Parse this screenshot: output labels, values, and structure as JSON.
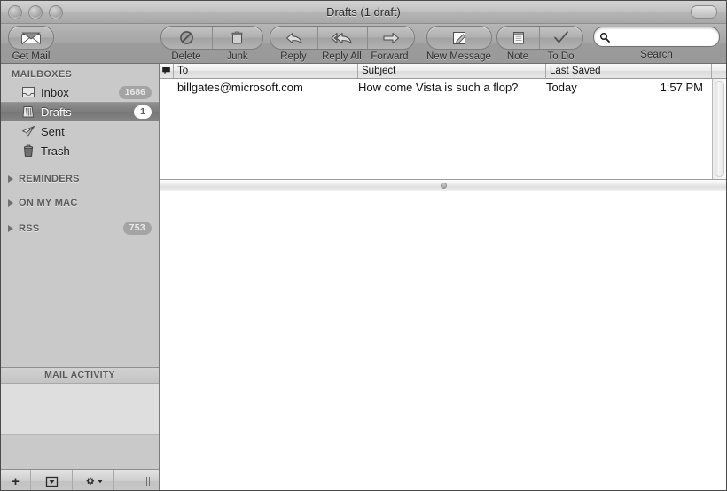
{
  "window": {
    "title": "Drafts (1 draft)",
    "traffic_lights": [
      "close",
      "minimize",
      "zoom"
    ],
    "toolbar_toggle": "toolbar-toggle-pill"
  },
  "toolbar": {
    "get_mail": {
      "label": "Get Mail",
      "icon": "envelope-icon"
    },
    "delete": {
      "label": "Delete",
      "icon": "no-entry-icon"
    },
    "junk": {
      "label": "Junk",
      "icon": "junk-bin-icon"
    },
    "reply": {
      "label": "Reply",
      "icon": "reply-arrow-icon"
    },
    "reply_all": {
      "label": "Reply All",
      "icon": "reply-all-arrow-icon"
    },
    "forward": {
      "label": "Forward",
      "icon": "forward-arrow-icon"
    },
    "new_message": {
      "label": "New Message",
      "icon": "compose-pencil-icon"
    },
    "note": {
      "label": "Note",
      "icon": "note-pad-icon"
    },
    "todo": {
      "label": "To Do",
      "icon": "checkmark-icon"
    },
    "search": {
      "label": "Search",
      "placeholder": "",
      "value": "",
      "icon": "search-icon"
    }
  },
  "sidebar": {
    "sections": [
      {
        "name": "MAILBOXES",
        "collapsible": false,
        "expanded": true,
        "items": [
          {
            "label": "Inbox",
            "icon": "inbox-tray-icon",
            "count": "1686",
            "selected": false
          },
          {
            "label": "Drafts",
            "icon": "drafts-icon",
            "count": "1",
            "selected": true
          },
          {
            "label": "Sent",
            "icon": "sent-paper-plane-icon",
            "count": "",
            "selected": false
          },
          {
            "label": "Trash",
            "icon": "trash-can-icon",
            "count": "",
            "selected": false
          }
        ]
      },
      {
        "name": "REMINDERS",
        "collapsible": true,
        "expanded": false,
        "count": "",
        "items": []
      },
      {
        "name": "ON MY MAC",
        "collapsible": true,
        "expanded": false,
        "count": "",
        "items": []
      },
      {
        "name": "RSS",
        "collapsible": true,
        "expanded": false,
        "count": "753",
        "items": []
      }
    ],
    "activity": {
      "title": "MAIL ACTIVITY"
    },
    "bottom_bar": {
      "add": "+",
      "actions_icon": "mailbox-actions-icon",
      "gear_icon": "gear-icon",
      "resize_grip": "resize-grip-icon"
    }
  },
  "message_list": {
    "columns": [
      {
        "key": "flag",
        "label": "",
        "icon": "flag-bubble-icon"
      },
      {
        "key": "to",
        "label": "To"
      },
      {
        "key": "subject",
        "label": "Subject"
      },
      {
        "key": "last_saved",
        "label": "Last Saved"
      }
    ],
    "rows": [
      {
        "flag": "",
        "to": "billgates@microsoft.com",
        "subject": "How come Vista is such a flop?",
        "date": "Today",
        "time": "1:57 PM"
      }
    ]
  },
  "preview": {
    "content": ""
  },
  "colors": {
    "titlebar": "#bcbcbc",
    "toolbar": "#a3a3a3",
    "sidebar": "#c9c9c9",
    "selected_row": "#7c7c7c",
    "badge": "#a4a4a4",
    "list_background": "#ffffff"
  }
}
